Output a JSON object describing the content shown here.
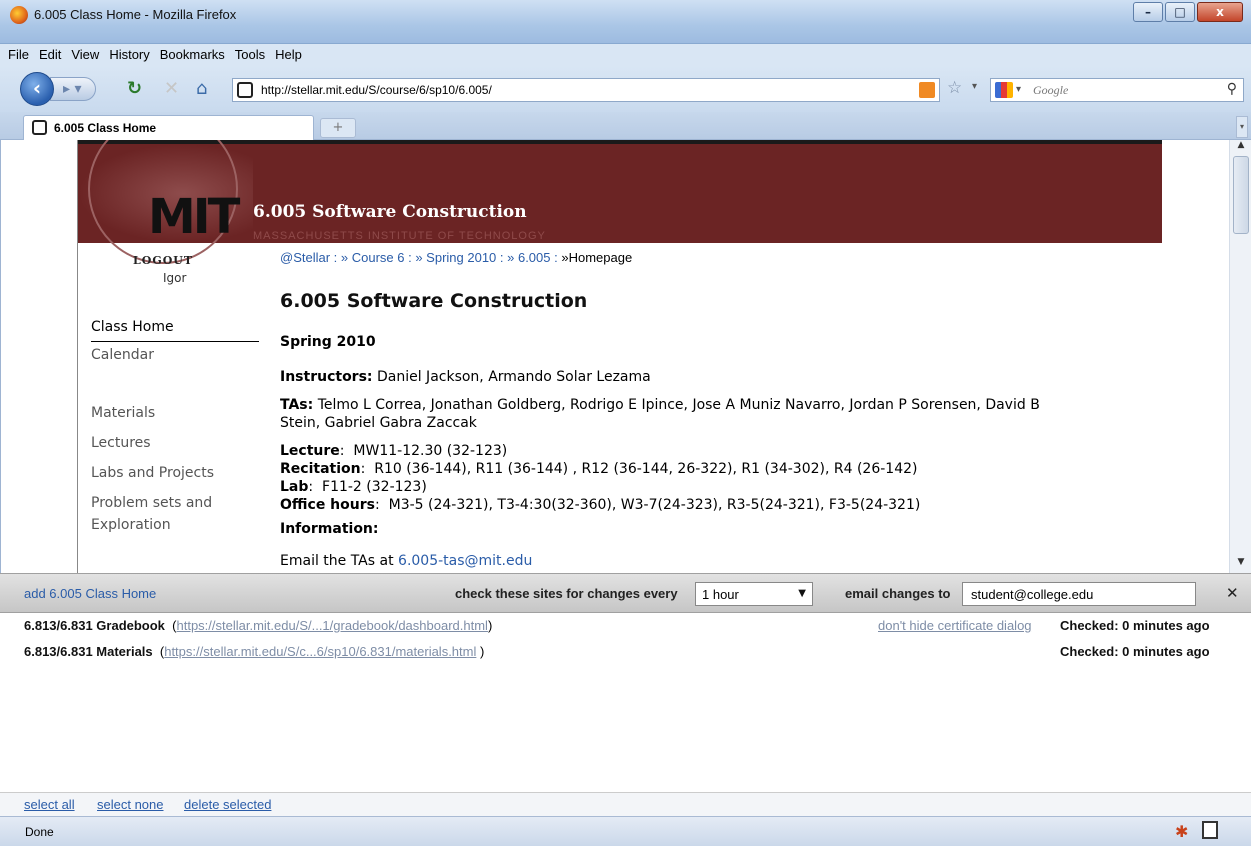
{
  "window": {
    "title": "6.005 Class Home - Mozilla Firefox",
    "minimize": "–",
    "maximize": "□",
    "close": "x"
  },
  "menu": [
    "File",
    "Edit",
    "View",
    "History",
    "Bookmarks",
    "Tools",
    "Help"
  ],
  "navbar": {
    "url": "http://stellar.mit.edu/S/course/6/sp10/6.005/",
    "search_placeholder": "Google"
  },
  "tab": {
    "label": "6.005 Class Home",
    "new_tab": "+"
  },
  "page": {
    "banner_title": "6.005  Software Construction",
    "banner_subtitle": "MASSACHUSETTS INSTITUTE OF TECHNOLOGY",
    "logo_text": "MIT",
    "logout": "LOGOUT",
    "username": "Igor",
    "breadcrumb": {
      "links": [
        "@Stellar",
        "» Course 6",
        "» Spring 2010",
        "» 6.005"
      ],
      "current": "»Homepage"
    },
    "nav": [
      "Class Home",
      "Calendar",
      "Materials",
      "Lectures",
      "Labs and Projects",
      "Problem sets and",
      "Exploration"
    ],
    "heading": "6.005  Software Construction",
    "term": "Spring 2010",
    "instructors_label": "Instructors:",
    "instructors": "Daniel Jackson, Armando Solar Lezama",
    "tas_label": "TAs:",
    "tas_line1": "Telmo L Correa, Jonathan Goldberg, Rodrigo E Ipince, Jose A Muniz Navarro, Jordan P Sorensen, David B",
    "tas_line2": "Stein, Gabriel Gabra Zaccak",
    "lecture_label": "Lecture",
    "lecture": "MW11-12.30  (32-123)",
    "recitation_label": "Recitation",
    "recitation": "R10 (36-144), R11 (36-144) , R12 (36-144, 26-322), R1 (34-302), R4 (26-142)",
    "lab_label": "Lab",
    "lab": "F11-2  (32-123)",
    "office_label": "Office hours",
    "office": "M3-5 (24-321), T3-4:30(32-360), W3-7(24-323), R3-5(24-321), F3-5(24-321)",
    "information_label": "Information:",
    "email_prefix": "Email the TAs at ",
    "email": "6.005-tas@mit.edu"
  },
  "panel": {
    "add_label": "add 6.005 Class Home",
    "check_label": "check these sites for changes every",
    "interval": "1 hour",
    "email_label": "email changes to",
    "email_value": "student@college.edu",
    "close": "✕",
    "sites": [
      {
        "name": "6.813/6.831 Gradebook",
        "url": "https://stellar.mit.edu/S/...1/gradebook/dashboard.html",
        "checked": "Checked: 0 minutes ago"
      },
      {
        "name": "6.813/6.831 Materials",
        "url": "https://stellar.mit.edu/S/c...6/sp10/6.831/materials.html",
        "checked": "Checked: 0 minutes ago"
      }
    ],
    "cert_link": "don't hide certificate dialog",
    "footer": [
      "select all",
      "select none",
      "delete selected"
    ]
  },
  "status": {
    "text": "Done"
  },
  "colors": {
    "banner": "#6b2424",
    "link": "#2a5ca8"
  }
}
